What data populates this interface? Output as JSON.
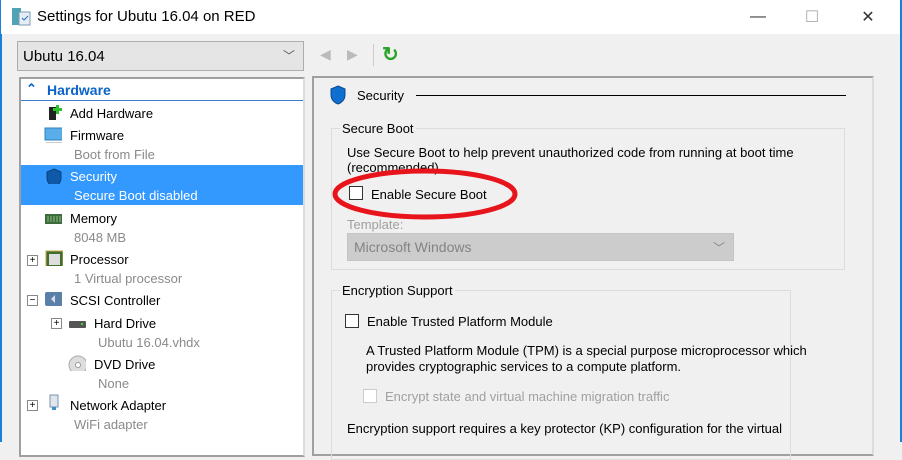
{
  "window": {
    "title": "Settings for Ubutu 16.04 on RED",
    "minimize": "—",
    "maximize": "☐",
    "close": "✕"
  },
  "vm_selector": {
    "value": "Ubutu 16.04"
  },
  "toolbar": {
    "back": "◀",
    "forward": "▶",
    "refresh": "↻"
  },
  "tree": {
    "header": "Hardware",
    "items": [
      {
        "label": "Add Hardware"
      },
      {
        "label": "Firmware",
        "sub": "Boot from File"
      },
      {
        "label": "Security",
        "sub": "Secure Boot disabled"
      },
      {
        "label": "Memory",
        "sub": "8048 MB"
      },
      {
        "label": "Processor",
        "sub": "1 Virtual processor"
      },
      {
        "label": "SCSI Controller"
      },
      {
        "label": "Hard Drive",
        "sub": "Ubutu 16.04.vhdx"
      },
      {
        "label": "DVD Drive",
        "sub": "None"
      },
      {
        "label": "Network Adapter",
        "sub": "WiFi adapter"
      }
    ]
  },
  "panel": {
    "title": "Security",
    "secure_boot": {
      "group": "Secure Boot",
      "desc1": "Use Secure Boot to help prevent unauthorized code from running at boot time",
      "desc2": "(recommended).",
      "checkbox": "Enable Secure Boot",
      "checked": false,
      "template_label": "Template:",
      "template_value": "Microsoft Windows"
    },
    "encryption": {
      "group": "Encryption Support",
      "tpm_checkbox": "Enable Trusted Platform Module",
      "tpm_checked": false,
      "tpm_desc1": "A Trusted Platform Module (TPM) is a special purpose microprocessor which",
      "tpm_desc2": "provides cryptographic services to a compute platform.",
      "encrypt_checkbox": "Encrypt state and virtual machine migration traffic",
      "note": "Encryption support requires a key protector (KP) configuration for the virtual"
    }
  },
  "colors": {
    "accent": "#3399ff",
    "annotation": "#e8141b"
  }
}
